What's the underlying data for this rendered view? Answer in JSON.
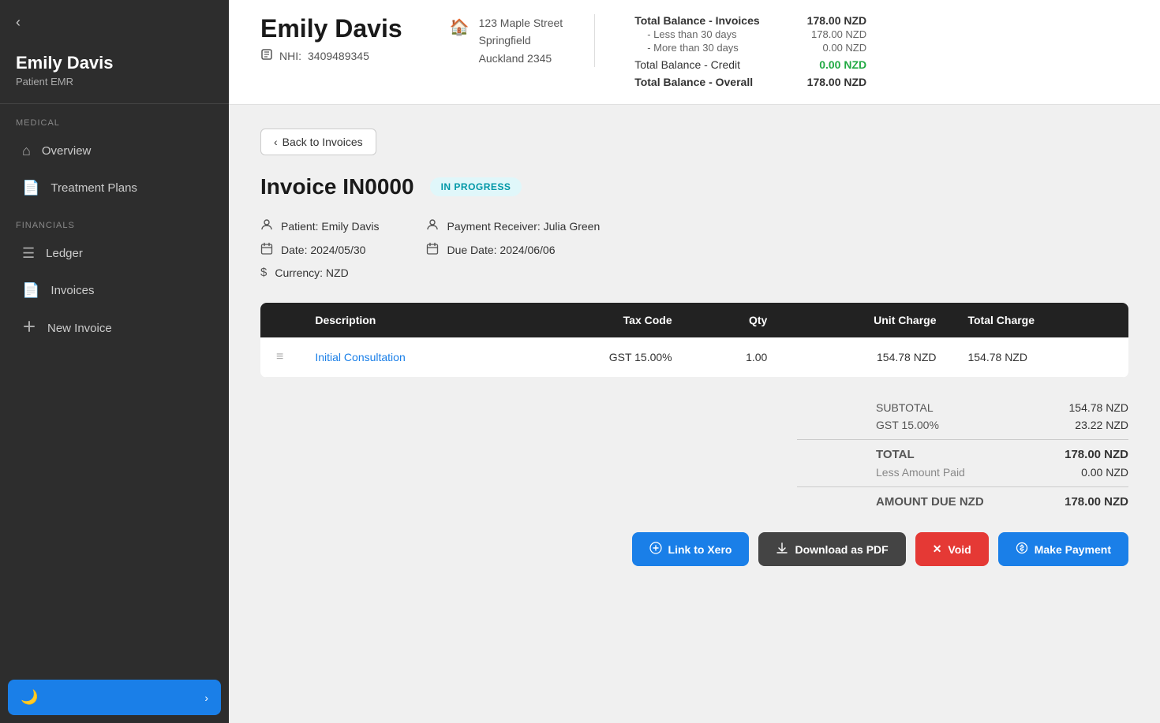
{
  "sidebar": {
    "back_icon": "‹",
    "patient_name": "Emily Davis",
    "patient_label": "Patient EMR",
    "sections": [
      {
        "label": "MEDICAL",
        "items": [
          {
            "id": "overview",
            "label": "Overview",
            "icon": "⌂"
          },
          {
            "id": "treatment-plans",
            "label": "Treatment Plans",
            "icon": "📄"
          }
        ]
      },
      {
        "label": "FINANCIALS",
        "items": [
          {
            "id": "ledger",
            "label": "Ledger",
            "icon": "☰"
          },
          {
            "id": "invoices",
            "label": "Invoices",
            "icon": "📄"
          },
          {
            "id": "new-invoice",
            "label": "New Invoice",
            "icon": "➕"
          }
        ]
      }
    ],
    "toggle_icon": "🌙",
    "toggle_arrow": "›"
  },
  "header": {
    "patient_name": "Emily Davis",
    "nhi_label": "NHI:",
    "nhi_value": "3409489345",
    "address": {
      "line1": "123 Maple Street",
      "line2": "Springfield",
      "line3": "Auckland 2345"
    },
    "balance": {
      "total_invoices_label": "Total Balance - Invoices",
      "total_invoices_value": "178.00 NZD",
      "less_30_label": "- Less than 30 days",
      "less_30_value": "178.00 NZD",
      "more_30_label": "- More than 30 days",
      "more_30_value": "0.00 NZD",
      "total_credit_label": "Total Balance - Credit",
      "total_credit_value": "0.00 NZD",
      "total_overall_label": "Total Balance - Overall",
      "total_overall_value": "178.00 NZD"
    }
  },
  "invoice": {
    "back_button_label": "Back to Invoices",
    "title": "Invoice IN0000",
    "status": "IN PROGRESS",
    "patient_label": "Patient: Emily Davis",
    "payment_receiver_label": "Payment Receiver: Julia Green",
    "date_label": "Date: 2024/05/30",
    "due_date_label": "Due Date: 2024/06/06",
    "currency_label": "Currency: NZD",
    "table": {
      "columns": [
        "Description",
        "Tax Code",
        "Qty",
        "Unit Charge",
        "Total Charge"
      ],
      "rows": [
        {
          "description": "Initial Consultation",
          "tax_code": "GST 15.00%",
          "qty": "1.00",
          "unit_charge": "154.78 NZD",
          "total_charge": "154.78 NZD"
        }
      ]
    },
    "totals": {
      "subtotal_label": "SUBTOTAL",
      "subtotal_value": "154.78 NZD",
      "gst_label": "GST 15.00%",
      "gst_value": "23.22 NZD",
      "total_label": "TOTAL",
      "total_value": "178.00 NZD",
      "less_paid_label": "Less Amount Paid",
      "less_paid_value": "0.00 NZD",
      "amount_due_label": "AMOUNT DUE NZD",
      "amount_due_value": "178.00 NZD"
    },
    "actions": {
      "link_xero": "Link to Xero",
      "download_pdf": "Download as PDF",
      "void": "Void",
      "make_payment": "Make Payment"
    }
  }
}
